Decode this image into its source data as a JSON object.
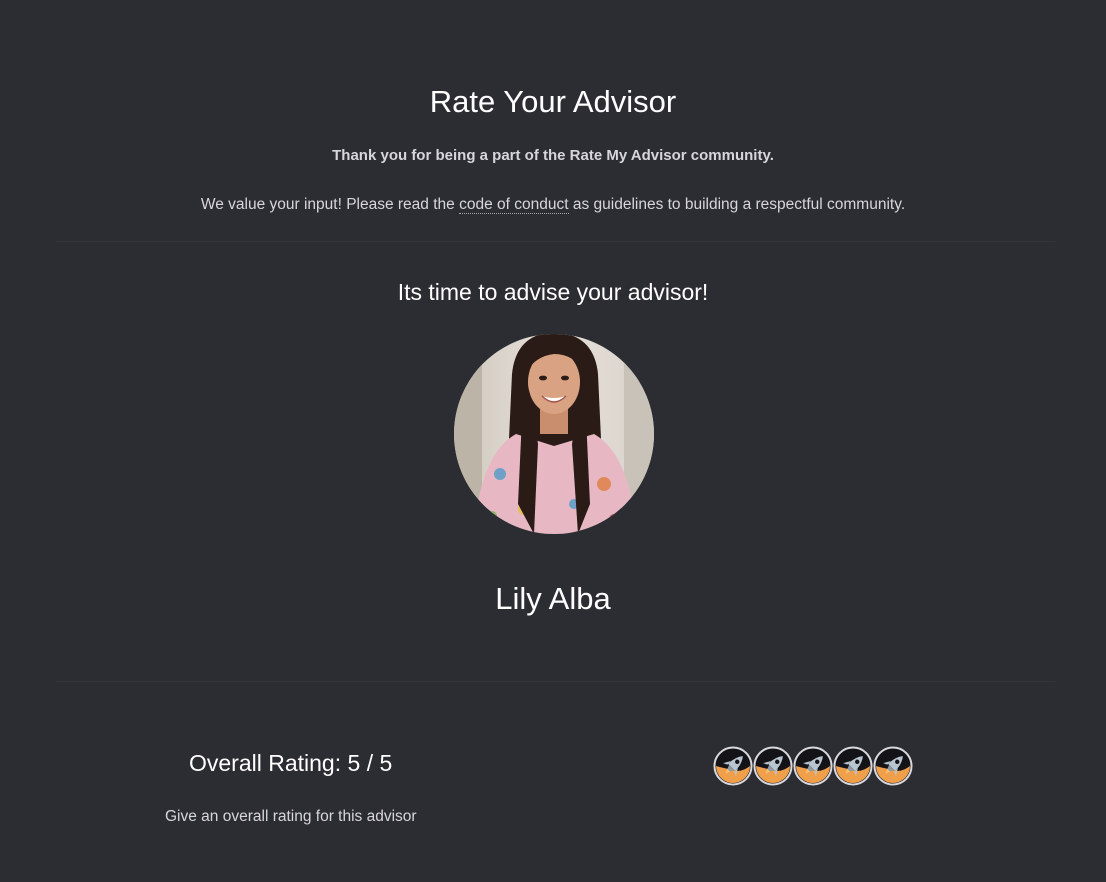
{
  "header": {
    "title": "Rate Your Advisor",
    "thanks": "Thank you for being a part of the Rate My Advisor community.",
    "intro_before": "We value your input! Please read the ",
    "intro_link": "code of conduct",
    "intro_after": " as guidelines to building a respectful community."
  },
  "advisor": {
    "prompt": "Its time to advise your advisor!",
    "name": "Lily Alba",
    "photo_icon": "advisor-portrait"
  },
  "rating": {
    "label": "Overall Rating: 5 / 5",
    "help": "Give an overall rating for this advisor",
    "value": 5,
    "max": 5,
    "icon": "rocket-icon",
    "icon_colors": {
      "ring": "#d9d9de",
      "lower": "#f0a04b",
      "upper": "#141418",
      "rocket": "#b8c4cf"
    }
  },
  "colors": {
    "background": "#2c2c33",
    "text": "#ffffff",
    "muted_text": "#d6d6dc"
  }
}
